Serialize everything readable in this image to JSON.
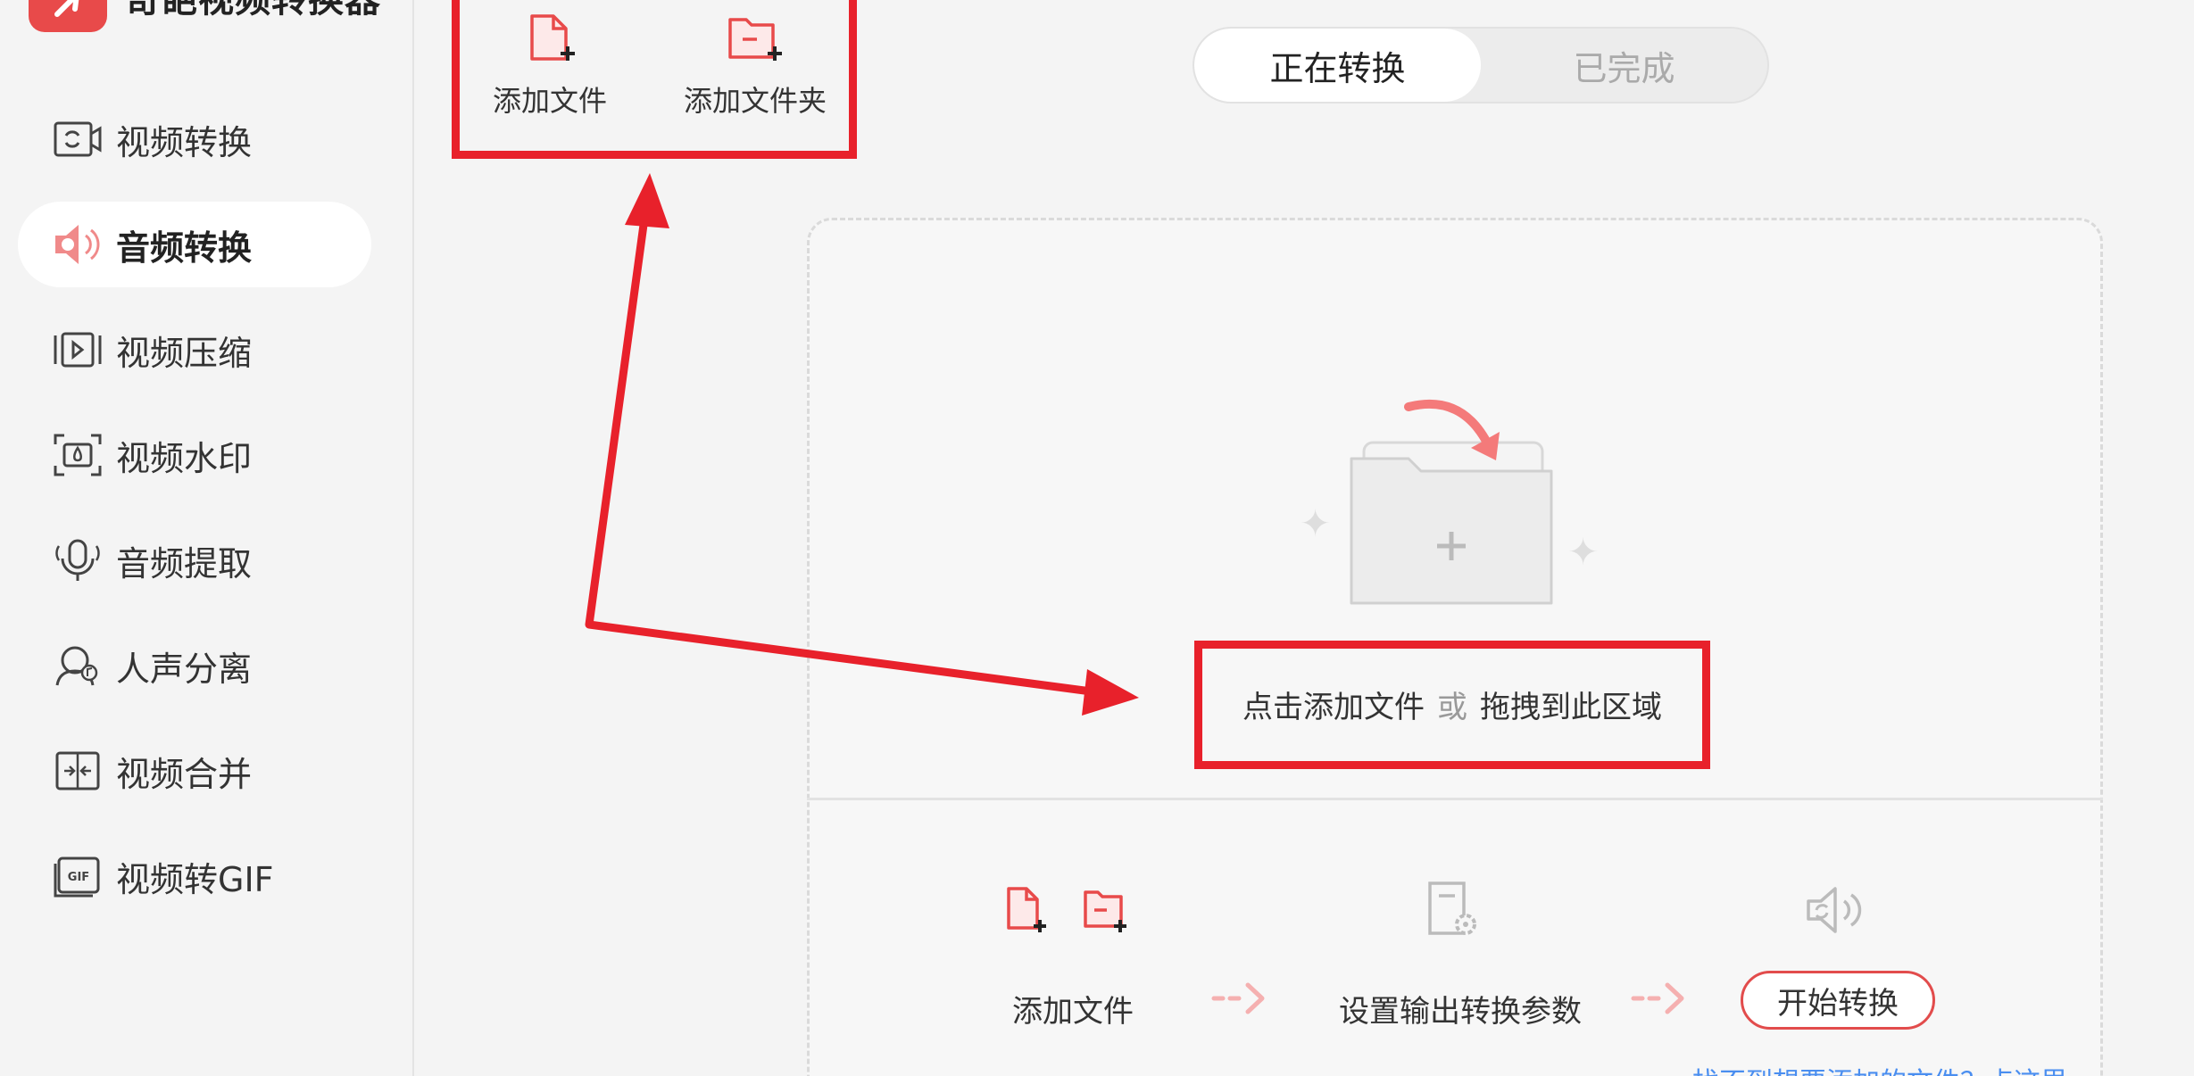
{
  "app": {
    "name": "奇葩视频转换器",
    "accent_color": "#e84a4a"
  },
  "sidebar": {
    "items": [
      {
        "label": "视频转换",
        "icon": "video-convert-icon",
        "active": false
      },
      {
        "label": "音频转换",
        "icon": "audio-convert-icon",
        "active": true
      },
      {
        "label": "视频压缩",
        "icon": "video-compress-icon",
        "active": false
      },
      {
        "label": "视频水印",
        "icon": "video-watermark-icon",
        "active": false
      },
      {
        "label": "音频提取",
        "icon": "audio-extract-icon",
        "active": false
      },
      {
        "label": "人声分离",
        "icon": "vocal-separation-icon",
        "active": false
      },
      {
        "label": "视频合并",
        "icon": "video-merge-icon",
        "active": false
      },
      {
        "label": "视频转GIF",
        "icon": "video-to-gif-icon",
        "active": false
      }
    ]
  },
  "toolbar": {
    "add_file_label": "添加文件",
    "add_folder_label": "添加文件夹"
  },
  "tabs": {
    "converting": "正在转换",
    "completed": "已完成",
    "active": "converting"
  },
  "dropzone": {
    "prompt_part1": "点击添加文件",
    "prompt_or": "或",
    "prompt_part2": "拖拽到此区域"
  },
  "steps": {
    "add_file": "添加文件",
    "set_params": "设置输出转换参数",
    "start_button": "开始转换"
  },
  "help_link": "找不到想要添加的文件？点这里",
  "annotation": {
    "color": "#e8212b"
  }
}
